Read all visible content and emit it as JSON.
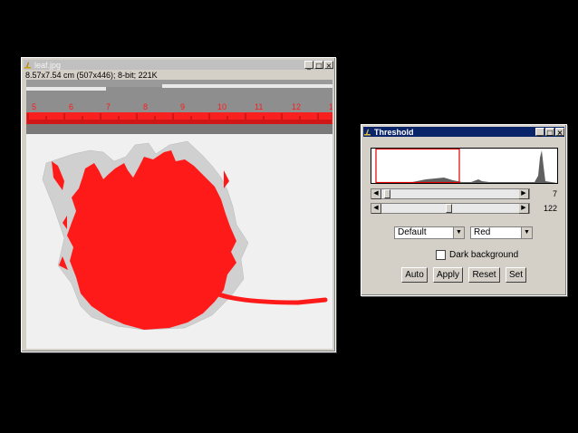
{
  "image_window": {
    "title": "leaf.jpg",
    "info": "8.57x7.54 cm (507x446); 8-bit; 221K",
    "ruler_numbers": [
      "5",
      "6",
      "7",
      "8",
      "9",
      "10",
      "11",
      "12",
      "13"
    ],
    "overlay_color": "#ff1a1a"
  },
  "threshold_window": {
    "title": "Threshold",
    "slider_min_value": "7",
    "slider_max_value": "122",
    "slider_min_position": 0.03,
    "slider_max_position": 0.48,
    "method_select": "Default",
    "display_select": "Red",
    "dark_background_label": "Dark background",
    "dark_background_checked": false,
    "buttons": {
      "auto": "Auto",
      "apply": "Apply",
      "reset": "Reset",
      "set": "Set"
    }
  },
  "window_buttons": {
    "minimize": "_",
    "maximize": "□",
    "close": "×"
  }
}
